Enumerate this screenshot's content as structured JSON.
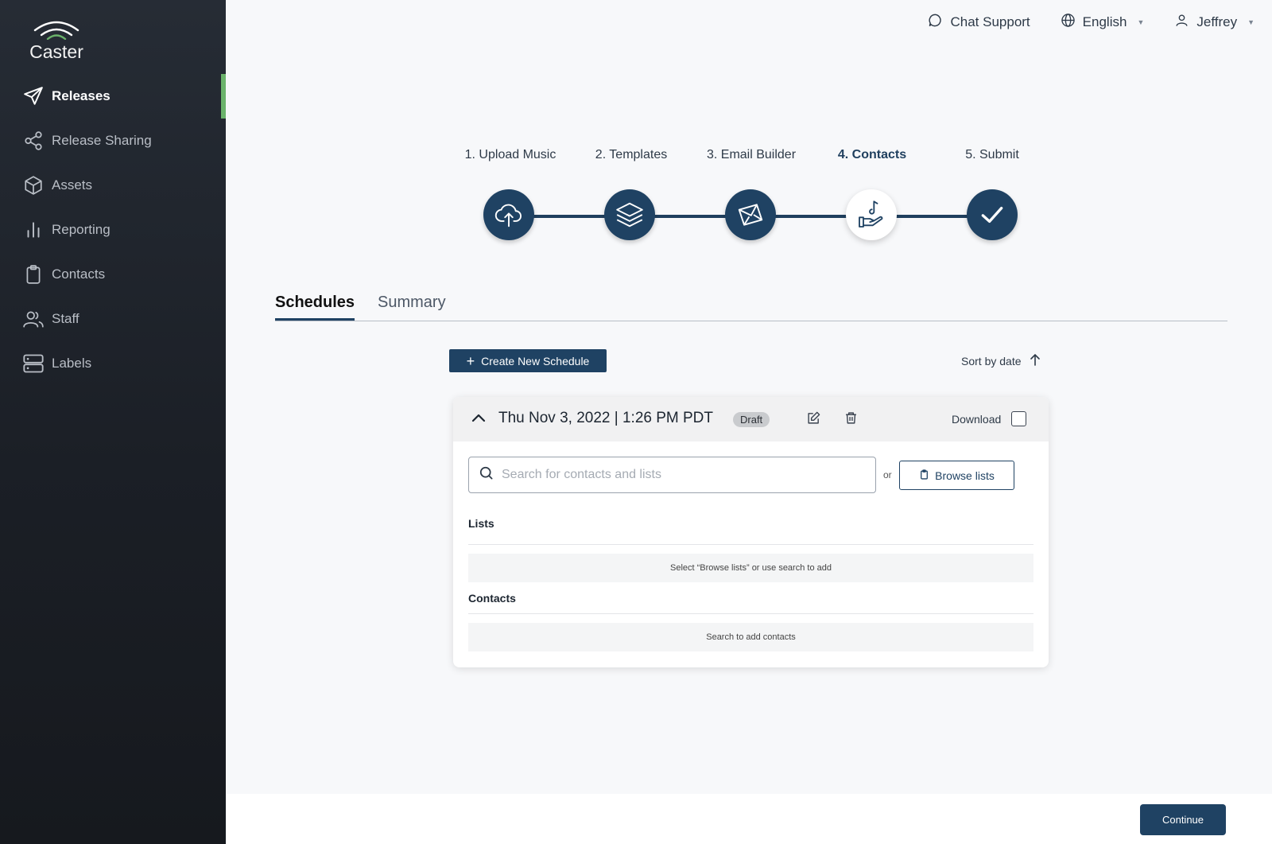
{
  "app": {
    "name": "Caster"
  },
  "sidebar": {
    "items": [
      {
        "label": "Releases",
        "icon": "paper-plane-icon",
        "active": true
      },
      {
        "label": "Release Sharing",
        "icon": "share-icon"
      },
      {
        "label": "Assets",
        "icon": "box-icon"
      },
      {
        "label": "Reporting",
        "icon": "bar-chart-icon"
      },
      {
        "label": "Contacts",
        "icon": "clipboard-icon"
      },
      {
        "label": "Staff",
        "icon": "users-icon"
      },
      {
        "label": "Labels",
        "icon": "server-icon"
      }
    ]
  },
  "topbar": {
    "chat_support": "Chat Support",
    "language": "English",
    "user": "Jeffrey"
  },
  "stepper": {
    "steps": [
      {
        "label": "1. Upload Music",
        "icon": "cloud-upload-icon"
      },
      {
        "label": "2. Templates",
        "icon": "layers-icon"
      },
      {
        "label": "3. Email Builder",
        "icon": "envelope-icon"
      },
      {
        "label": "4. Contacts",
        "icon": "hand-music-note-icon",
        "current": true
      },
      {
        "label": "5. Submit",
        "icon": "checkmark-icon"
      }
    ]
  },
  "tabs": {
    "schedules": "Schedules",
    "summary": "Summary"
  },
  "actions": {
    "create_schedule": "Create New Schedule",
    "sort_by": "Sort by date"
  },
  "schedule": {
    "title": "Thu Nov 3, 2022 | 1:26 PM PDT",
    "status": "Draft",
    "download_label": "Download",
    "download_checked": false,
    "search_placeholder": "Search for contacts and lists",
    "or_text": "or",
    "browse_label": "Browse lists",
    "lists_heading": "Lists",
    "lists_empty": "Select “Browse lists” or use search to add",
    "contacts_heading": "Contacts",
    "contacts_empty": "Search to add contacts"
  },
  "footer": {
    "continue": "Continue"
  },
  "colors": {
    "primary": "#1f4263",
    "sidebar": "#1b1f26",
    "accent": "#6bb36b"
  }
}
